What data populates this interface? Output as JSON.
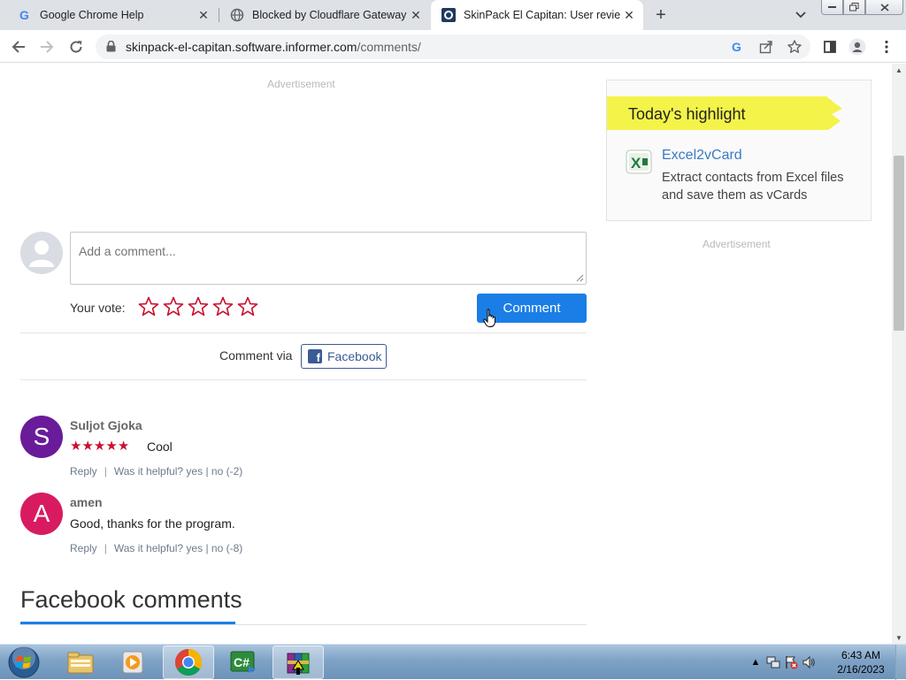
{
  "browser": {
    "tabs": [
      {
        "title": "Google Chrome Help",
        "icon": "google-g-icon"
      },
      {
        "title": "Blocked by Cloudflare Gateway",
        "icon": "globe-icon"
      },
      {
        "title": "SkinPack El Capitan: User reviews",
        "icon": "informer-icon",
        "active": true
      }
    ],
    "url_domain": "skinpack-el-capitan.software.informer.com",
    "url_path": "/comments/"
  },
  "page": {
    "ad_label": "Advertisement",
    "sidebar_ad_label": "Advertisement",
    "comment_form": {
      "placeholder": "Add a comment...",
      "vote_label": "Your vote:",
      "stars_total": 5,
      "submit_label": "Comment"
    },
    "comment_via": {
      "label": "Comment via",
      "facebook_label": "Facebook"
    },
    "reviews": [
      {
        "initial": "S",
        "avatar_color": "#6a1b9a",
        "author": "Suljot Gjoka",
        "rating": 5,
        "text": "Cool",
        "reply": "Reply",
        "helpful": "Was it helpful?",
        "yes": "yes",
        "no": "no (-2)"
      },
      {
        "initial": "A",
        "avatar_color": "#d81b60",
        "author": "amen",
        "rating": 0,
        "text": "Good, thanks for the program.",
        "reply": "Reply",
        "helpful": "Was it helpful?",
        "yes": "yes",
        "no": "no (-8)"
      }
    ],
    "facebook_comments_heading": "Facebook comments",
    "highlight": {
      "title": "Today's highlight",
      "app_name": "Excel2vCard",
      "app_description": "Extract contacts from Excel files and save them as vCards"
    }
  },
  "taskbar": {
    "time": "6:43 AM",
    "date": "2/16/2023",
    "apps": [
      "file-explorer-icon",
      "media-player-icon",
      "chrome-icon",
      "csharp-editor-icon",
      "winrar-icon"
    ]
  },
  "colors": {
    "accent": "#1a7ee6",
    "star_red": "#c8102e",
    "facebook": "#3b5b94",
    "highlight_yellow": "#f4f34a"
  }
}
